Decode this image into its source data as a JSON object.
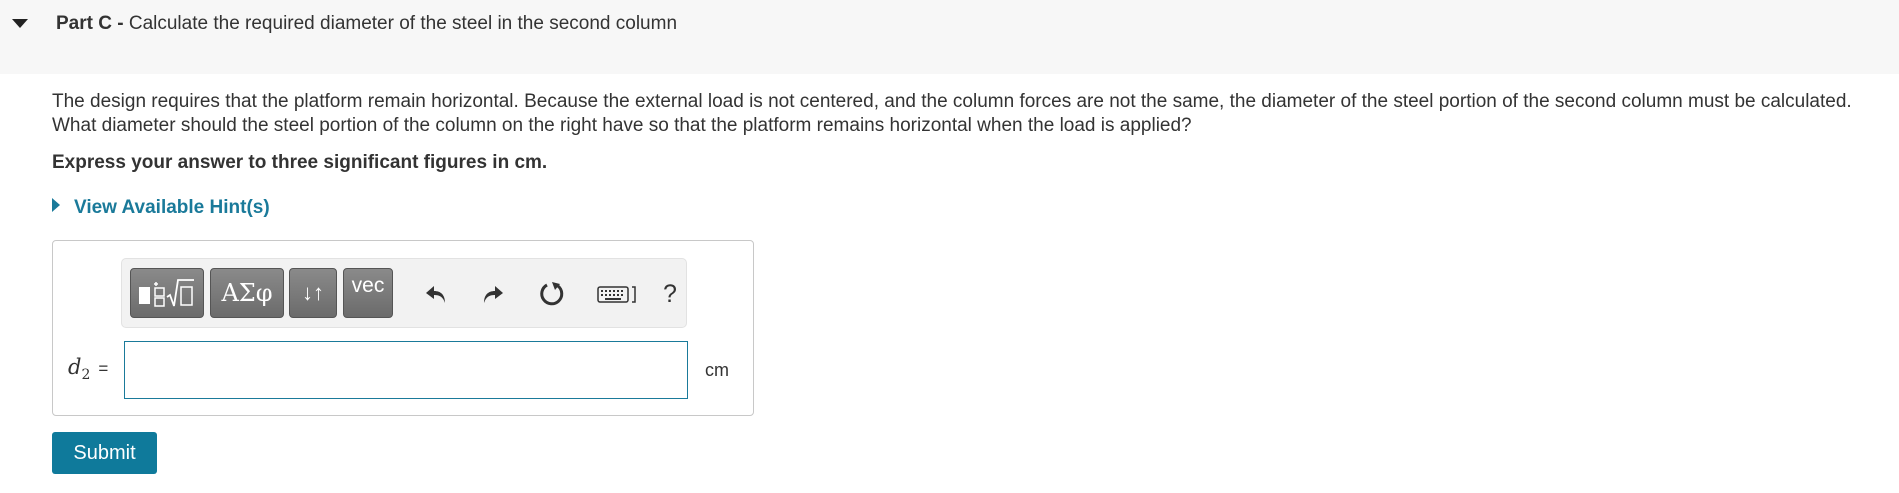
{
  "part": {
    "label": "Part C -",
    "title": "Calculate the required diameter of the steel in the second column"
  },
  "description": {
    "line1": "The design requires that the platform remain horizontal. Because the external load is not centered, and the column forces are not the same, the diameter of the steel portion of the second column must be calculated.",
    "line2": "What diameter should the steel portion of the column on the right have so that the platform remains horizontal when the load is applied?"
  },
  "instruction": "Express your answer to three significant figures in cm.",
  "hints_label": "View Available Hint(s)",
  "toolbar": {
    "greek_label": "ΑΣφ",
    "arrows_label": "↓↑",
    "vec_label": "vec",
    "help_label": "?",
    "icons": [
      "templates-icon",
      "greek-letters-icon",
      "subscript-superscript-icon",
      "vector-icon",
      "undo-icon",
      "redo-icon",
      "reset-icon",
      "keyboard-icon",
      "help-icon"
    ]
  },
  "answer": {
    "variable": "d",
    "subscript": "2",
    "equals": "=",
    "value": "",
    "unit": "cm"
  },
  "submit_label": "Submit",
  "colors": {
    "accent": "#0f7a9b",
    "link": "#1a7a9a",
    "header_bg": "#f7f7f7",
    "toolbar_button": "#777777"
  }
}
